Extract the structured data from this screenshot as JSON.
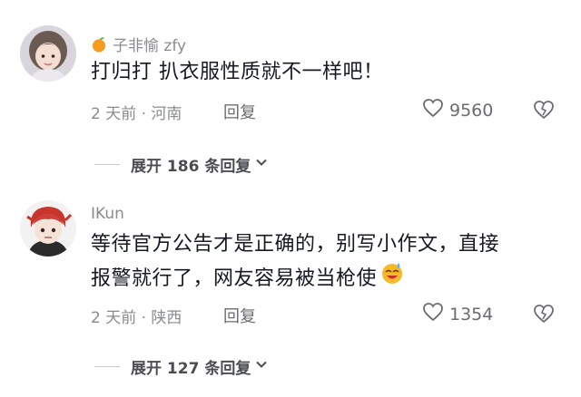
{
  "comments": [
    {
      "username": "子非愉 zfy",
      "username_icon": "tangerine-emoji-icon",
      "text": "打归打 扒衣服性质就不一样吧！",
      "time_location": "2 天前 · 河南",
      "reply_label": "回复",
      "likes": "9560",
      "expand_label": "展开 186 条回复"
    },
    {
      "username": "IKun",
      "text_line1": "等待官方公告才是正确的，别写小作文，直接",
      "text_line2": "报警就行了，网友容易被当枪使",
      "text_emoji": "sweat-smile-emoji-icon",
      "time_location": "2 天前 · 陕西",
      "reply_label": "回复",
      "likes": "1354",
      "expand_label": "展开 127 条回复"
    }
  ],
  "colors": {
    "text": "#161823",
    "secondary": "#8a8b91",
    "icon": "#6b6c72"
  }
}
